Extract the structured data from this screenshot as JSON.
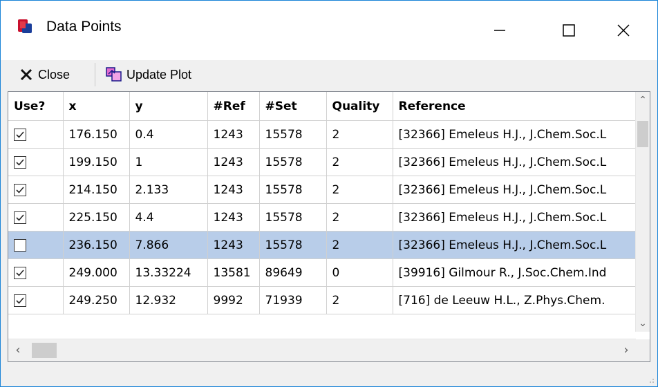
{
  "window": {
    "title": "Data Points"
  },
  "toolbar": {
    "close_label": "Close",
    "update_label": "Update Plot"
  },
  "grid": {
    "columns": [
      "Use?",
      "x",
      "y",
      "#Ref",
      "#Set",
      "Quality",
      "Reference"
    ],
    "rows": [
      {
        "use": true,
        "x": "176.150",
        "y": "0.4",
        "ref": "1243",
        "set": "15578",
        "quality": "2",
        "reference": "[32366] Emeleus H.J., J.Chem.Soc.L"
      },
      {
        "use": true,
        "x": "199.150",
        "y": "1",
        "ref": "1243",
        "set": "15578",
        "quality": "2",
        "reference": "[32366] Emeleus H.J., J.Chem.Soc.L"
      },
      {
        "use": true,
        "x": "214.150",
        "y": "2.133",
        "ref": "1243",
        "set": "15578",
        "quality": "2",
        "reference": "[32366] Emeleus H.J., J.Chem.Soc.L"
      },
      {
        "use": true,
        "x": "225.150",
        "y": "4.4",
        "ref": "1243",
        "set": "15578",
        "quality": "2",
        "reference": "[32366] Emeleus H.J., J.Chem.Soc.L"
      },
      {
        "use": false,
        "x": "236.150",
        "y": "7.866",
        "ref": "1243",
        "set": "15578",
        "quality": "2",
        "reference": "[32366] Emeleus H.J., J.Chem.Soc.L",
        "selected": true
      },
      {
        "use": true,
        "x": "249.000",
        "y": "13.33224",
        "ref": "13581",
        "set": "89649",
        "quality": "0",
        "reference": "[39916] Gilmour R., J.Soc.Chem.Ind"
      },
      {
        "use": true,
        "x": "249.250",
        "y": "12.932",
        "ref": "9992",
        "set": "71939",
        "quality": "2",
        "reference": "[716] de Leeuw H.L., Z.Phys.Chem."
      }
    ]
  },
  "colors": {
    "selection": "#b8cde9",
    "window_border": "#1883d7"
  },
  "icons": {
    "app": "app-icon",
    "close": "close-x-icon",
    "update": "update-plot-icon"
  }
}
